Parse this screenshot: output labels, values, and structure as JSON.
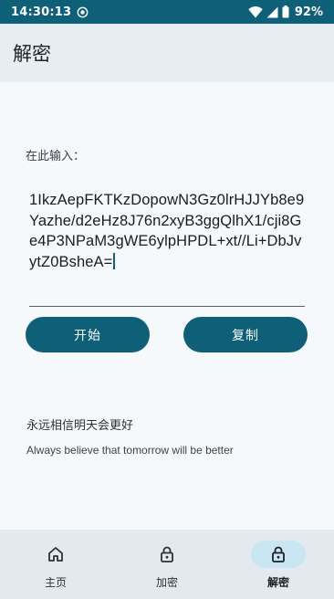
{
  "status_bar": {
    "time": "14:30:13",
    "battery": "92%"
  },
  "app_bar": {
    "title": "解密"
  },
  "main": {
    "prompt_label": "在此输入：",
    "input_value": "1IkzAepFKTKzDopowN3Gz0lrHJJYb8e9Yazhe/d2eHz8J76n2xyB3ggQlhX1/cji8Ge4P3NPaM3gWE6ylpHPDL+xt//Li+DbJvytZ0BsheA=",
    "start_button": "开始",
    "copy_button": "复制",
    "motto_cn": "永远相信明天会更好",
    "motto_en": "Always believe that tomorrow will be better"
  },
  "bottom_nav": {
    "items": [
      {
        "label": "主页",
        "icon": "home-icon",
        "active": false
      },
      {
        "label": "加密",
        "icon": "lock-icon",
        "active": false
      },
      {
        "label": "解密",
        "icon": "lock-icon",
        "active": true
      }
    ]
  },
  "colors": {
    "primary": "#0e6078",
    "app_bar_bg": "#e6eef3",
    "nav_active_bg": "#c9e6f2"
  }
}
